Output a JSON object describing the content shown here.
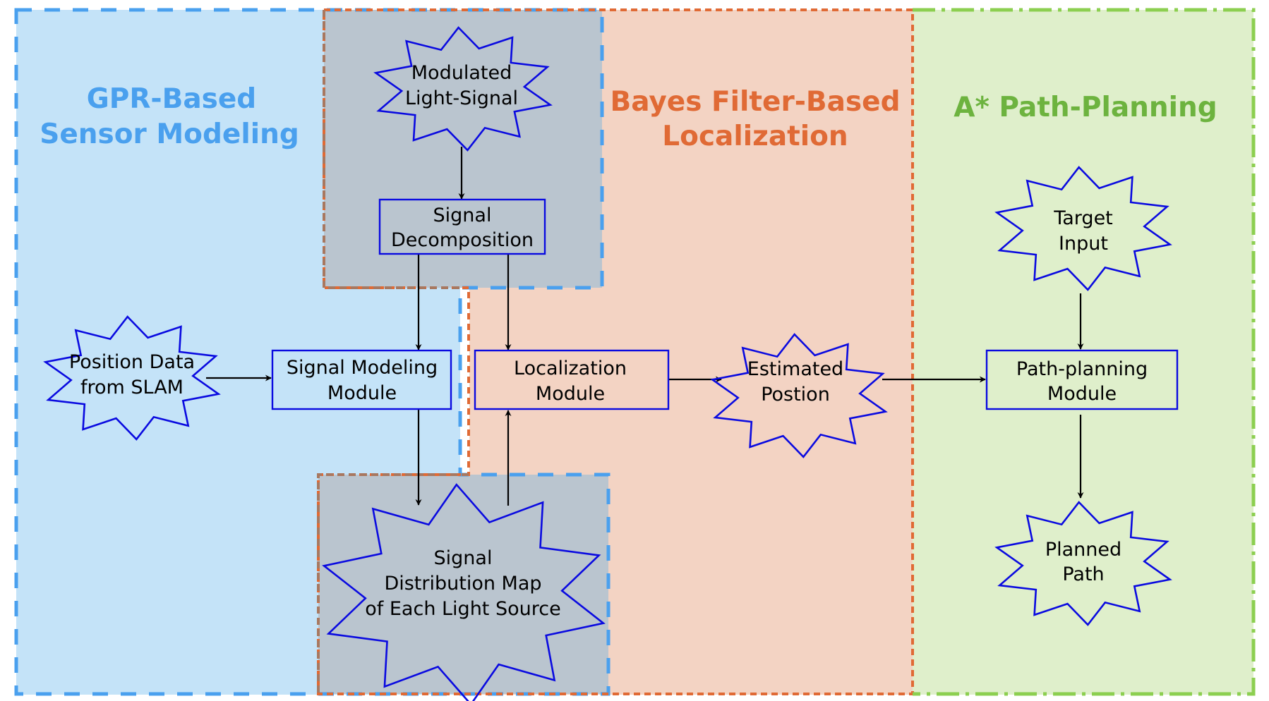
{
  "regions": {
    "gpr": {
      "title_line1": "GPR-Based",
      "title_line2": "Sensor Modeling",
      "color": "#4aa0ee",
      "fill": "#c4e3f8"
    },
    "bayes": {
      "title_line1": "Bayes Filter-Based",
      "title_line2": "Localization",
      "color": "#e06a35",
      "fill": "#f3d3c3"
    },
    "astar": {
      "title_line1": "A* Path-Planning",
      "color": "#6db33f",
      "fill": "#dfefcb"
    },
    "shared": {
      "fill": "#bac5cf",
      "border": "#a87860"
    }
  },
  "nodes": {
    "modulated_light_signal": {
      "line1": "Modulated",
      "line2": "Light-Signal",
      "shape": "star"
    },
    "signal_decomposition": {
      "line1": "Signal",
      "line2": "Decomposition",
      "shape": "box"
    },
    "position_data": {
      "line1": "Position Data",
      "line2": "from SLAM",
      "shape": "star"
    },
    "signal_modeling_module": {
      "line1": "Signal Modeling",
      "line2": "Module",
      "shape": "box"
    },
    "localization_module": {
      "line1": "Localization",
      "line2": "Module",
      "shape": "box"
    },
    "estimated_position": {
      "line1": "Estimated",
      "line2": "Postion",
      "shape": "star"
    },
    "signal_distribution_map": {
      "line1": "Signal",
      "line2": "Distribution Map",
      "line3": "of Each Light Source",
      "shape": "star"
    },
    "target_input": {
      "line1": "Target",
      "line2": "Input",
      "shape": "star"
    },
    "path_planning_module": {
      "line1": "Path-planning",
      "line2": "Module",
      "shape": "box"
    },
    "planned_path": {
      "line1": "Planned",
      "line2": "Path",
      "shape": "star"
    }
  },
  "edges": [
    {
      "from": "modulated_light_signal",
      "to": "signal_decomposition"
    },
    {
      "from": "signal_decomposition",
      "to": "signal_modeling_module"
    },
    {
      "from": "signal_decomposition",
      "to": "localization_module"
    },
    {
      "from": "position_data",
      "to": "signal_modeling_module"
    },
    {
      "from": "signal_modeling_module",
      "to": "signal_distribution_map"
    },
    {
      "from": "signal_distribution_map",
      "to": "localization_module"
    },
    {
      "from": "localization_module",
      "to": "estimated_position"
    },
    {
      "from": "estimated_position",
      "to": "path_planning_module"
    },
    {
      "from": "target_input",
      "to": "path_planning_module"
    },
    {
      "from": "path_planning_module",
      "to": "planned_path"
    }
  ],
  "style": {
    "node_stroke": "#0a0ae0",
    "edge_color": "#000000"
  }
}
